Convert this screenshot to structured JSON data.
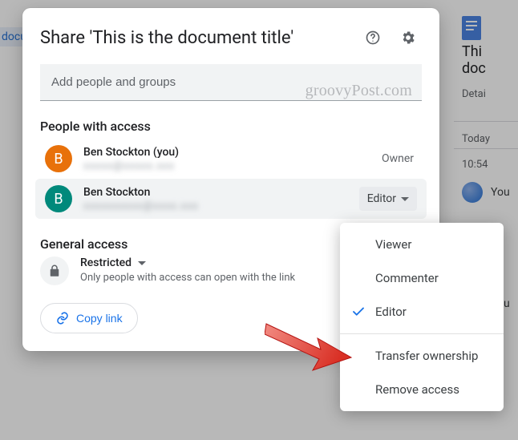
{
  "dialog": {
    "title": "Share 'This is the document title'",
    "add_placeholder": "Add people and groups",
    "watermark": "groovyPost.com",
    "people_section": "People with access",
    "general_section": "General access",
    "people": [
      {
        "initial": "B",
        "name": "Ben Stockton (you)",
        "email_masked": "xxxxx@xxxxx.xxx",
        "role": "Owner"
      },
      {
        "initial": "B",
        "name": "Ben Stockton",
        "email_masked": "xxxxxxxxxx@xxxx.xxx",
        "role": "Editor"
      }
    ],
    "general": {
      "label": "Restricted",
      "sub": "Only people with access can open with the link"
    },
    "copy_label": "Copy link"
  },
  "menu": {
    "items": [
      "Viewer",
      "Commenter",
      "Editor"
    ],
    "selected": "Editor",
    "actions": [
      "Transfer ownership",
      "Remove access"
    ]
  },
  "background": {
    "side_tab": "docu",
    "title1": "Thi",
    "title2": "doc",
    "detail": "Detai",
    "today": "Today",
    "time": "10:54",
    "you": "You"
  }
}
